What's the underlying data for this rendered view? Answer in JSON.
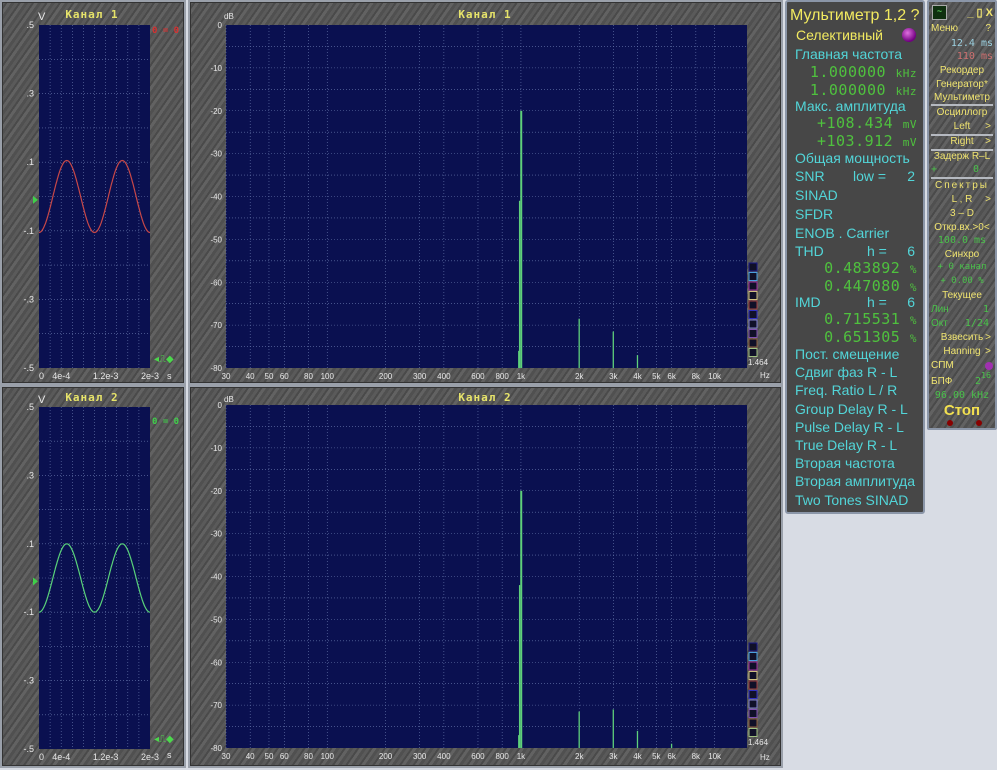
{
  "colors": {
    "plot_bg": "#0a1050",
    "grid": "#6a7bb0",
    "ch1_trace": "#c84848",
    "ch2_trace": "#5ad37a",
    "spectrum": "#5fd07a",
    "label_yellow": "#e6e36a",
    "label_cyan": "#52d5d8",
    "value_green": "#4fc13e"
  },
  "scopes": [
    {
      "title": "Канал 1",
      "unit_y": "V",
      "unit_x": "s",
      "marker": "0 = 0",
      "marker_color": "#d83030",
      "trace_color": "#c84848",
      "amplitude": 0.105,
      "chart_data": {
        "type": "line",
        "ylim": [
          -0.5,
          0.5
        ],
        "xlim": [
          0,
          0.002
        ],
        "yticks": [
          ".5",
          ".3",
          ".1",
          "-.1",
          "-.3",
          "-.5"
        ],
        "ytick_values": [
          0.5,
          0.3,
          0.1,
          -0.1,
          -0.3,
          -0.5
        ],
        "xticks": [
          "0",
          "4e-4",
          "1.2e-3",
          "2e-3"
        ],
        "xtick_values": [
          0,
          0.0004,
          0.0012,
          0.002
        ],
        "frequency_hz": 1000,
        "grid": true
      }
    },
    {
      "title": "Канал 2",
      "unit_y": "V",
      "unit_x": "s",
      "marker": "0 = 0",
      "marker_color": "#3fd04a",
      "trace_color": "#5ad37a",
      "amplitude": 0.1,
      "chart_data": {
        "type": "line",
        "ylim": [
          -0.5,
          0.5
        ],
        "xlim": [
          0,
          0.002
        ],
        "yticks": [
          ".5",
          ".3",
          ".1",
          "-.1",
          "-.3",
          "-.5"
        ],
        "ytick_values": [
          0.5,
          0.3,
          0.1,
          -0.1,
          -0.3,
          -0.5
        ],
        "xticks": [
          "0",
          "4e-4",
          "1.2e-3",
          "2e-3"
        ],
        "xtick_values": [
          0,
          0.0004,
          0.0012,
          0.002
        ],
        "frequency_hz": 1000,
        "grid": true
      }
    }
  ],
  "spectra": [
    {
      "title": "Канал 1",
      "unit_y": "dB",
      "unit_x": "Hz",
      "scale_value": "1.464",
      "chart_data": {
        "type": "bar",
        "xscale": "log",
        "xlim": [
          30,
          14700
        ],
        "ylim": [
          -80,
          0
        ],
        "grid": true,
        "yticks": [
          "0",
          "-10",
          "-20",
          "-30",
          "-40",
          "-50",
          "-60",
          "-70",
          "-80"
        ],
        "xticks": [
          "30",
          "40",
          "50",
          "60",
          "80",
          "100",
          "200",
          "300",
          "400",
          "600",
          "800",
          "1k",
          "2k",
          "3k",
          "4k",
          "5k",
          "6k",
          "8k",
          "10k"
        ],
        "xtick_values": [
          30,
          40,
          50,
          60,
          80,
          100,
          200,
          300,
          400,
          600,
          800,
          1000,
          2000,
          3000,
          4000,
          5000,
          6000,
          8000,
          10000
        ],
        "peaks": [
          {
            "f": 1000,
            "db": -20
          },
          {
            "f": 985,
            "db": -41
          },
          {
            "f": 975,
            "db": -76
          },
          {
            "f": 2000,
            "db": -68.5
          },
          {
            "f": 3000,
            "db": -71.5
          },
          {
            "f": 4000,
            "db": -77
          }
        ]
      }
    },
    {
      "title": "Канал 2",
      "unit_y": "dB",
      "unit_x": "Hz",
      "scale_value": "1.464",
      "chart_data": {
        "type": "bar",
        "xscale": "log",
        "xlim": [
          30,
          14700
        ],
        "ylim": [
          -80,
          0
        ],
        "grid": true,
        "yticks": [
          "0",
          "-10",
          "-20",
          "-30",
          "-40",
          "-50",
          "-60",
          "-70",
          "-80"
        ],
        "xticks": [
          "30",
          "40",
          "50",
          "60",
          "80",
          "100",
          "200",
          "300",
          "400",
          "600",
          "800",
          "1k",
          "2k",
          "3k",
          "4k",
          "5k",
          "6k",
          "8k",
          "10k"
        ],
        "xtick_values": [
          30,
          40,
          50,
          60,
          80,
          100,
          200,
          300,
          400,
          600,
          800,
          1000,
          2000,
          3000,
          4000,
          5000,
          6000,
          8000,
          10000
        ],
        "peaks": [
          {
            "f": 1000,
            "db": -20
          },
          {
            "f": 985,
            "db": -42
          },
          {
            "f": 975,
            "db": -77
          },
          {
            "f": 2000,
            "db": -71.5
          },
          {
            "f": 3000,
            "db": -71
          },
          {
            "f": 4000,
            "db": -76
          },
          {
            "f": 6000,
            "db": -79
          }
        ]
      }
    }
  ],
  "legend_colors": [
    "#1a1a8a",
    "#4aa0e0",
    "#a030a0",
    "#d0c080",
    "#a04040",
    "#3030c0",
    "#8080d0",
    "#8050b0",
    "#906040",
    "#a0c080"
  ],
  "multimeter": {
    "title": "Мультиметр 1,2 ?",
    "mode": "Селективный",
    "main_freq_label": "Главная частота",
    "main_freq": [
      "1.000000",
      "1.000000"
    ],
    "freq_unit": "kHz",
    "max_amp_label": "Макс. амплитуда",
    "max_amp": [
      "+108.434",
      "+103.912"
    ],
    "amp_unit": "mV",
    "total_power": "Общая мощность",
    "snr": "SNR",
    "snr_low": "low =",
    "snr_low_value": "2",
    "sinad": "SINAD",
    "sfdr": "SFDR",
    "enob": "ENOB . Carrier",
    "thd": "THD",
    "thd_h": "h =",
    "thd_h_value": "6",
    "thd_values": [
      "0.483892",
      "0.447080"
    ],
    "imd": "IMD",
    "imd_h": "h =",
    "imd_h_value": "6",
    "imd_values": [
      "0.715531",
      "0.651305"
    ],
    "pct": "%",
    "rest": [
      "Пост. смещение",
      "Сдвиг фаз R - L",
      "Freq. Ratio  L / R",
      "Group Delay R - L",
      "Pulse Delay R - L",
      "True Delay R - L",
      "Вторая частота",
      "Вторая амплитуда",
      "Two Tones SINAD"
    ]
  },
  "control": {
    "window_buttons": "_ ▯ X",
    "menu": "Меню",
    "help": "?",
    "time1": "12.4 ms",
    "time2": "110 ms",
    "recorder": "Рекордер",
    "generator": "Генератор*",
    "multimeter": "Мультиметр",
    "oscillograph": "Осциллогр",
    "left": "Left",
    "right": "Right",
    "arrow": ">",
    "delay": "Задерж  R–L",
    "delay_sign": "+",
    "delay_value": "0",
    "spectra": "Спектры",
    "lr": "L , R",
    "three_d": "3 – D",
    "open_input": "Откр.вх.>0<",
    "open_time": "100.0 ms",
    "sync": "Синхро",
    "sync_channel": "+ 0 канал",
    "sync_pct": "+ 0.00 %",
    "current": "Текущее",
    "lin": "Лин",
    "lin_value": "1",
    "oct": "Окт",
    "oct_value": "1/24",
    "weigh": "Взвесить",
    "hanning": "Hanning",
    "spm": "СПМ",
    "fft": "БПФ",
    "fft_value": "2",
    "fft_exp": "16",
    "sample_rate": "96.00 kHz",
    "stop": "Стоп"
  }
}
